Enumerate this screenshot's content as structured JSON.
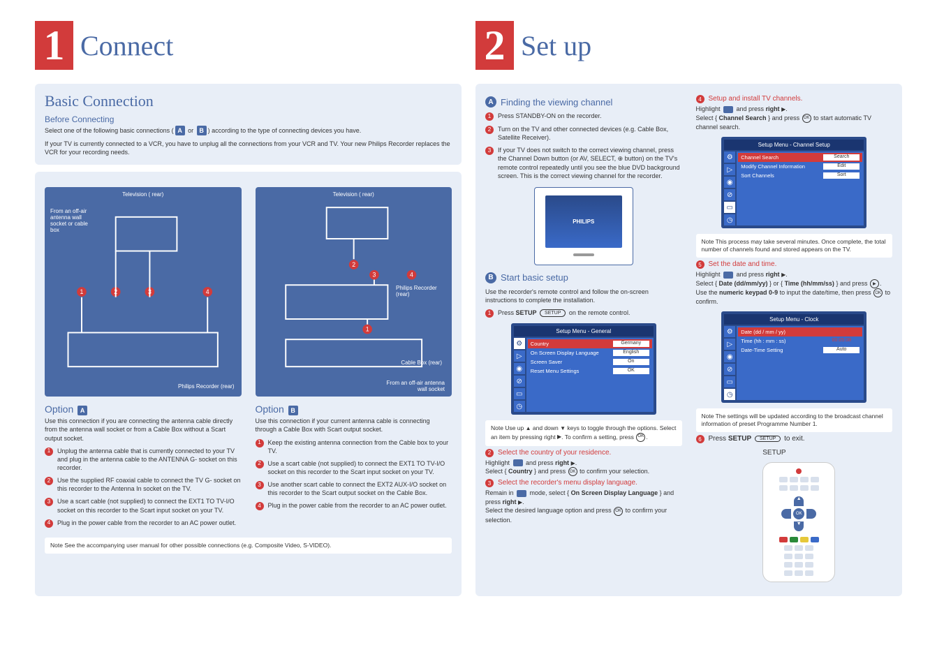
{
  "sheet1": {
    "number": "1",
    "title": "Connect",
    "section": "Basic Connection",
    "before_heading": "Before Connecting",
    "before_text1": "Select one of the following basic connections (",
    "before_text2": ") according to the type of connecting devices you have.",
    "before_badge_a": "A",
    "before_badge_b": "B",
    "before_or": " or ",
    "vcr_text": "If your TV is currently connected to a VCR, you have to unplug all the connections from your VCR and TV. Your new Philips Recorder replaces the VCR for your recording needs.",
    "diagramA": {
      "tv_label": "Television ( rear)",
      "source_label": "From an off-air antenna wall socket or cable box",
      "recorder_label": "Philips Recorder (rear)"
    },
    "diagramB": {
      "tv_label": "Television ( rear)",
      "recorder_label": "Philips Recorder (rear)",
      "cable_label": "Cable Box (rear)",
      "source_label": "From an off-air antenna wall socket"
    },
    "optionA": {
      "title": "Option ",
      "letter": "A",
      "intro": "Use this connection if you are connecting the antenna cable directly from the antenna wall socket or from a Cable Box without a Scart output socket.",
      "steps": [
        "Unplug the antenna cable that is currently connected to your TV and plug in the antenna cable to the ANTENNA G- socket on this recorder.",
        "Use the supplied RF coaxial cable to connect the TV G- socket on this recorder to the Antenna In socket on the TV.",
        "Use a scart cable (not supplied) to connect the EXT1 TO TV-I/O socket on this recorder to the Scart input socket on your TV.",
        "Plug in the power cable from the recorder to an AC power outlet."
      ]
    },
    "optionB": {
      "title": "Option ",
      "letter": "B",
      "intro": "Use this connection if your current antenna cable is connecting through a Cable Box with Scart output socket.",
      "steps": [
        "Keep the existing antenna connection from the Cable box to your TV.",
        "Use a scart cable (not supplied) to connect the EXT1 TO TV-I/O socket on this recorder to the Scart input socket on your TV.",
        "Use another scart cable to connect the EXT2 AUX-I/O socket on this recorder to the Scart output socket on the Cable Box.",
        "Plug in the power cable from the recorder to an AC power outlet."
      ]
    },
    "footer_note": "Note   See the accompanying user manual for other possible connections (e.g. Composite Video, S-VIDEO)."
  },
  "sheet2": {
    "number": "2",
    "title": "Set up",
    "sectionA": {
      "letter": "A",
      "title": "Finding the viewing channel",
      "steps": [
        "Press STANDBY-ON on the recorder.",
        "Turn on the TV and other connected devices (e.g. Cable Box, Satellite Receiver).",
        "If your TV does not switch to the correct viewing channel, press the Channel Down button (or AV, SELECT, ⊕ button) on the TV's remote control repeatedly until you see the blue DVD background screen. This is the correct viewing channel for the recorder."
      ],
      "tv_logo": "PHILIPS"
    },
    "sectionB": {
      "letter": "B",
      "title": "Start basic setup",
      "intro": "Use the recorder's remote control and follow the on-screen instructions to complete the installation.",
      "step1_pre": "Press ",
      "step1_bold": "SETUP",
      "step1_btn": "SETUP",
      "step1_post": " on the remote control.",
      "menu1": {
        "title": "Setup Menu - General",
        "rows": [
          {
            "label": "Country",
            "value": "Germany",
            "hl": true
          },
          {
            "label": "On Screen Display Language",
            "value": "English"
          },
          {
            "label": "Screen Saver",
            "value": "On"
          },
          {
            "label": "Reset Menu Settings",
            "value": "OK"
          }
        ]
      },
      "note1_pre": "Note  Use up ",
      "note1_mid1": " and down ",
      "note1_mid2": " keys to toggle through the options. Select an item by pressing right ",
      "note1_post": ". To confirm a setting, press ",
      "ok_label": "OK",
      "step2_title": "Select the country of your residence.",
      "step2_l1a": "Highlight ",
      "step2_l1b": " and press ",
      "step2_l1c": "right ",
      "step2_l2a": "Select { ",
      "step2_l2b": "Country",
      "step2_l2c": " } and press ",
      "step2_l2d": " to confirm your selection.",
      "step3_title": "Select the recorder's menu display language.",
      "step3_l1a": "Remain in ",
      "step3_l1b": " mode, select { ",
      "step3_l1c": "On Screen Display Language",
      "step3_l1d": " } and press ",
      "step3_l1e": "right ",
      "step3_l2a": "Select the desired language option and press ",
      "step3_l2b": " to confirm your selection."
    },
    "right": {
      "step4_title": "Setup and install TV channels.",
      "step4_l1a": "Highlight ",
      "step4_l1b": " and press ",
      "step4_l1c": "right ",
      "step4_l2a": "Select { ",
      "step4_l2b": "Channel Search",
      "step4_l2c": " } and press ",
      "step4_l2d": " to start automatic TV channel search.",
      "menu2": {
        "title": "Setup Menu - Channel Setup",
        "rows": [
          {
            "label": "Channel Search",
            "value": "Search",
            "hl": true
          },
          {
            "label": "Modify Channel Information",
            "value": "Edit"
          },
          {
            "label": "Sort Channels",
            "value": "Sort"
          }
        ]
      },
      "note2": "Note  This process may take several minutes. Once complete, the total number of channels found and stored appears on the TV.",
      "step5_title": "Set the date and time.",
      "step5_l1a": "Highlight ",
      "step5_l1b": " and press ",
      "step5_l1c": "right ",
      "step5_l2a": "Select { ",
      "step5_l2b": "Date (dd/mm/yy)",
      "step5_l2c": " } or { ",
      "step5_l2d": "Time (hh/mm/ss)",
      "step5_l2e": " } and press ",
      "step5_l2f": ". Use the ",
      "step5_l2g": "numeric keypad 0-9",
      "step5_l2h": " to input the date/time, then press ",
      "step5_l2i": " to confirm.",
      "menu3": {
        "title": "Setup Menu - Clock",
        "rows": [
          {
            "label": "Date (dd / mm / yy)",
            "value": "01/01/06"
          },
          {
            "label": "Time (hh : mm : ss)",
            "value": "00:05:08"
          },
          {
            "label": "Date-Time Setting",
            "value": "Auto"
          }
        ]
      },
      "note3": "Note  The settings will be updated according to the broadcast channel information of preset Programme Number 1.",
      "step6_pre": "Press ",
      "step6_bold": "SETUP",
      "step6_btn": "SETUP",
      "step6_post": " to exit.",
      "remote_ok": "OK",
      "remote_setup": "SETUP",
      "dpad_up": "▲",
      "dpad_down": "▼"
    }
  }
}
